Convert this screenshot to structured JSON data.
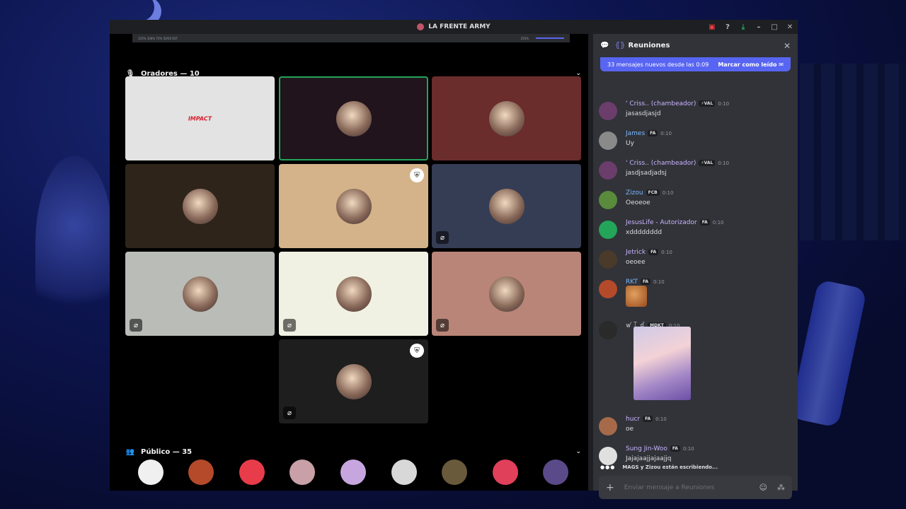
{
  "window": {
    "title": "LA FRENTE ARMY"
  },
  "stream_toolbar": {
    "left": "125% 100% 75% 50/50 ESF",
    "zoom": "255%"
  },
  "speakers": {
    "label": "Oradores — 10"
  },
  "tiles": [
    {
      "bg": "#e3e3e3",
      "avatar": "impact-logo",
      "logo_text": "IMPACT",
      "speaking": false,
      "muted": false,
      "shield": false
    },
    {
      "bg": "#21141c",
      "avatar": "zeintwit-avatar",
      "speaking": true,
      "muted": false,
      "shield": false
    },
    {
      "bg": "#6b2c2c",
      "avatar": "user-avatar",
      "speaking": false,
      "muted": false,
      "shield": false
    },
    {
      "bg": "#2e241a",
      "avatar": "panda-avatar",
      "speaking": false,
      "muted": false,
      "shield": false
    },
    {
      "bg": "#d4b38a",
      "avatar": "cat-avatar",
      "speaking": false,
      "muted": false,
      "shield": true
    },
    {
      "bg": "#353d54",
      "avatar": "user-avatar",
      "speaking": false,
      "muted": true,
      "shield": false
    },
    {
      "bg": "#b9bcb7",
      "avatar": "user-avatar",
      "speaking": false,
      "muted": true,
      "shield": false
    },
    {
      "bg": "#f1f1e3",
      "avatar": "teletubby-avatar",
      "speaking": false,
      "muted": true,
      "shield": false
    },
    {
      "bg": "#b98578",
      "avatar": "helmet-avatar",
      "speaking": false,
      "muted": true,
      "shield": false
    },
    {
      "bg": "#1e1e1e",
      "avatar": "user-avatar",
      "speaking": false,
      "muted": true,
      "shield": true
    }
  ],
  "audience": {
    "label": "Público — 35",
    "members": [
      {
        "name": "",
        "color": "#f0f0f0"
      },
      {
        "name": "",
        "color": "#b44a2a"
      },
      {
        "name": "",
        "color": "#e83c4a"
      },
      {
        "name": "",
        "color": "#c9a0a8"
      },
      {
        "name": "",
        "color": "#c7a6e0"
      },
      {
        "name": "",
        "color": "#d8d8d8"
      },
      {
        "name": "",
        "color": "#6a5a3c"
      },
      {
        "name": "",
        "color": "#e0405a"
      },
      {
        "name": "",
        "color": "#5b4a8a"
      }
    ]
  },
  "chat": {
    "channel": "Reuniones",
    "new_messages": "33 mensajes nuevos desde las 0:09",
    "mark_read": "Marcar como leído",
    "messages": [
      {
        "author": "' Criss.. (chambeador)",
        "color": "#c9b3ff",
        "tag": "⚡VAL",
        "time": "0:10",
        "text": "jasasdjasjd",
        "avatar": "#6b3d6b",
        "kind": "text"
      },
      {
        "author": "James",
        "color": "#7ab8ff",
        "tag": "FA",
        "time": "0:10",
        "text": "Uy",
        "avatar": "#8a8a8a",
        "kind": "text"
      },
      {
        "author": "' Criss.. (chambeador)",
        "color": "#c9b3ff",
        "tag": "⚡VAL",
        "time": "0:10",
        "text": "jasdjsadjadsj",
        "avatar": "#6b3d6b",
        "kind": "text"
      },
      {
        "author": "Zizou",
        "color": "#7ab8ff",
        "tag": "FCB",
        "time": "0:10",
        "text": "Oeoeoe",
        "avatar": "#5a8a3c",
        "kind": "text"
      },
      {
        "author": "JesusLife - Autorizador",
        "color": "#c9b3ff",
        "tag": "FA",
        "time": "0:10",
        "text": "xdddddddd",
        "avatar": "#23a55a",
        "kind": "text"
      },
      {
        "author": "Jetrick",
        "color": "#c9b3ff",
        "tag": "FA",
        "time": "0:10",
        "text": "oeoee",
        "avatar": "#4a3a2a",
        "kind": "text"
      },
      {
        "author": "RKT",
        "color": "#7ab8ff",
        "tag": "FA",
        "time": "0:10",
        "text": "",
        "avatar": "#b44a2a",
        "kind": "sticker"
      },
      {
        "author": "ꪝ ꀤ ꀸ",
        "color": "#dbdee1",
        "tag": "MDKT",
        "time": "0:10",
        "text": "",
        "avatar": "#2a2a2a",
        "kind": "image"
      },
      {
        "author": "hucr",
        "color": "#c9b3ff",
        "tag": "FA",
        "time": "0:10",
        "text": "oe",
        "avatar": "#a66a4a",
        "kind": "text"
      },
      {
        "author": "Sung Jin-Woo",
        "color": "#c9b3ff",
        "tag": "FA",
        "time": "0:10",
        "text": "Jajajaajjajaajjq",
        "avatar": "#e0e0e0",
        "kind": "text"
      }
    ],
    "typing": "MAGS y Zizou están escribiendo...",
    "composer_placeholder": "Enviar mensaje a  Reuniones"
  }
}
